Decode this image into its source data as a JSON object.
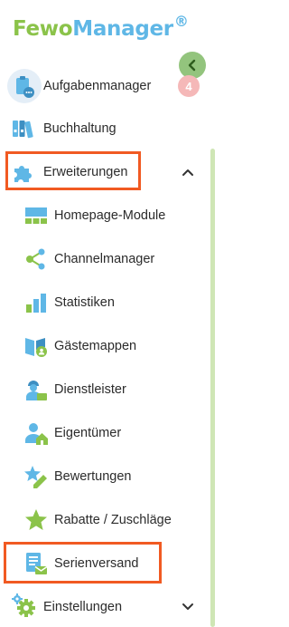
{
  "logo": {
    "part1": "Fewo",
    "part2": "Manager",
    "reg": "®"
  },
  "menu": {
    "aufgaben": {
      "label": "Aufgabenmanager",
      "badge": "4"
    },
    "buchhaltung": {
      "label": "Buchhaltung"
    },
    "erweiterungen": {
      "label": "Erweiterungen",
      "expanded": true,
      "items": {
        "homepage": {
          "label": "Homepage-Module"
        },
        "channel": {
          "label": "Channelmanager"
        },
        "statistiken": {
          "label": "Statistiken"
        },
        "gaestemappen": {
          "label": "Gästemappen"
        },
        "dienstleister": {
          "label": "Dienstleister"
        },
        "eigentuemer": {
          "label": "Eigentümer"
        },
        "bewertungen": {
          "label": "Bewertungen"
        },
        "rabatte": {
          "label": "Rabatte / Zuschläge"
        },
        "serienversand": {
          "label": "Serienversand"
        }
      }
    },
    "einstellungen": {
      "label": "Einstellungen",
      "expanded": false
    }
  },
  "colors": {
    "green": "#8bc34a",
    "blue": "#5fb7e6",
    "highlight": "#f15a22",
    "badge": "#f5b8b8"
  },
  "icons": {
    "collapse": "chevron-left-icon",
    "aufgaben": "clipboard-icon",
    "buchhaltung": "binders-icon",
    "erweiterungen": "puzzle-icon",
    "homepage": "layout-grid-icon",
    "channel": "share-nodes-icon",
    "statistiken": "bar-chart-icon",
    "gaestemappen": "guest-book-icon",
    "dienstleister": "service-person-icon",
    "eigentuemer": "owner-house-icon",
    "bewertungen": "star-pencil-icon",
    "rabatte": "star-icon",
    "serienversand": "mail-document-icon",
    "einstellungen": "gears-icon"
  }
}
